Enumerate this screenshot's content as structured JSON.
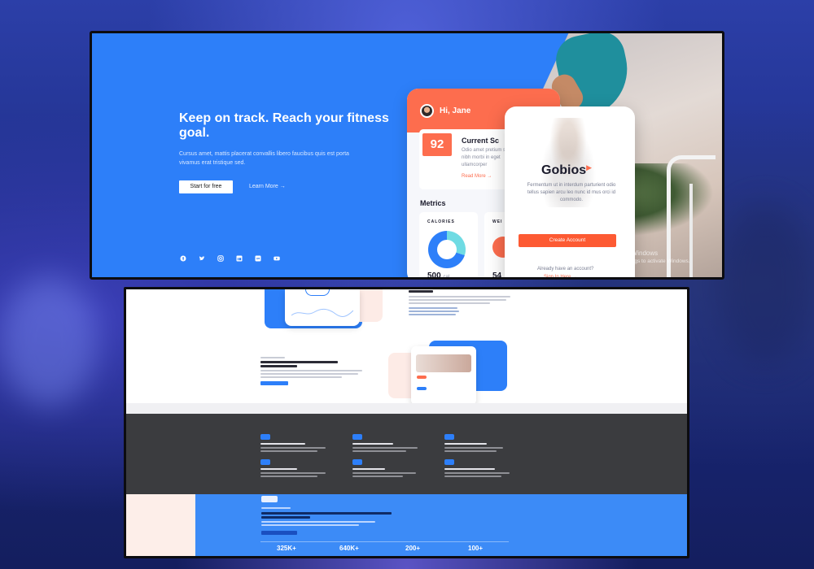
{
  "hero": {
    "title": "Keep on track. Reach your fitness goal.",
    "subtitle": "Cursus amet, mattis placerat convallis libero faucibus quis est porta vivamus erat tristique sed.",
    "start_label": "Start for free",
    "learn_label": "Learn More →"
  },
  "social": {
    "icons": [
      "facebook-icon",
      "twitter-icon",
      "instagram-icon",
      "linkedin-icon",
      "vk-icon",
      "youtube-icon"
    ]
  },
  "phone1": {
    "greeting": "Hi, Jane",
    "score": "92",
    "score_title": "Current Sc",
    "score_text": "Odio amet pretium sed nibh morbi in eget ullamcorper",
    "read_more": "Read More →",
    "metrics_title": "Metrics",
    "card1_label": "CALORIES",
    "card1_value": "500",
    "card1_unit": "cal",
    "card2_label": "WEI",
    "card2_value": "54"
  },
  "phone2": {
    "brand": "Gobios",
    "text": "Fermentum ut in interdum parturient odio tellus sapien arcu leo nunc id mus orci id commodo.",
    "create_label": "Create Account",
    "already": "Already have an account?",
    "signin": "Sign In Here →"
  },
  "watermark": {
    "line1": "Activate Windows",
    "line2": "Go to Settings to activate Windows."
  },
  "stats": {
    "s1": "325K+",
    "s2": "640K+",
    "s3": "200+",
    "s4": "100+"
  },
  "colors": {
    "primary": "#2d7ff9",
    "accent": "#fd6d4e",
    "dark": "#3b3c3f"
  }
}
